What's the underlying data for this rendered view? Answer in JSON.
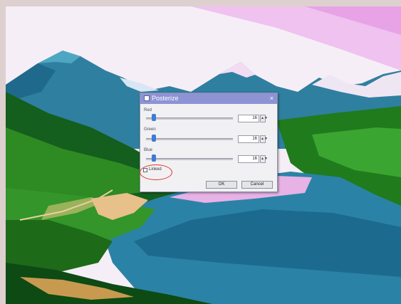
{
  "dialog": {
    "title": "Posterize",
    "close_glyph": "×",
    "sliders": [
      {
        "label": "Red",
        "value": "16",
        "level": 0.07
      },
      {
        "label": "Green",
        "value": "16",
        "level": 0.07
      },
      {
        "label": "Blue",
        "value": "16",
        "level": 0.07
      }
    ],
    "spin_glyph": "▲▼",
    "linked_label": "Linked",
    "linked_checked": false,
    "ok_label": "OK",
    "cancel_label": "Cancel"
  },
  "colors": {
    "title_bar": "#8e93d4",
    "slider_thumb": "#3e7bd4",
    "annotation": "#e0302e"
  }
}
